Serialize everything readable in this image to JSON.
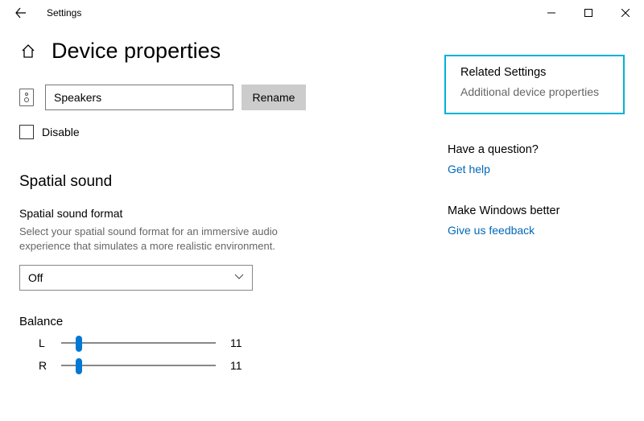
{
  "titlebar": {
    "title": "Settings"
  },
  "page_title": "Device properties",
  "device": {
    "name_value": "Speakers",
    "rename_label": "Rename",
    "disable_label": "Disable"
  },
  "spatial": {
    "heading": "Spatial sound",
    "format_label": "Spatial sound format",
    "description": "Select your spatial sound format for an immersive audio experience that simulates a more realistic environment.",
    "selected": "Off"
  },
  "balance": {
    "heading": "Balance",
    "left_label": "L",
    "right_label": "R",
    "left_val": "11",
    "right_val": "11"
  },
  "side": {
    "related_title": "Related Settings",
    "related_link": "Additional device properties",
    "question_title": "Have a question?",
    "get_help": "Get help",
    "feedback_title": "Make Windows better",
    "feedback_link": "Give us feedback"
  }
}
